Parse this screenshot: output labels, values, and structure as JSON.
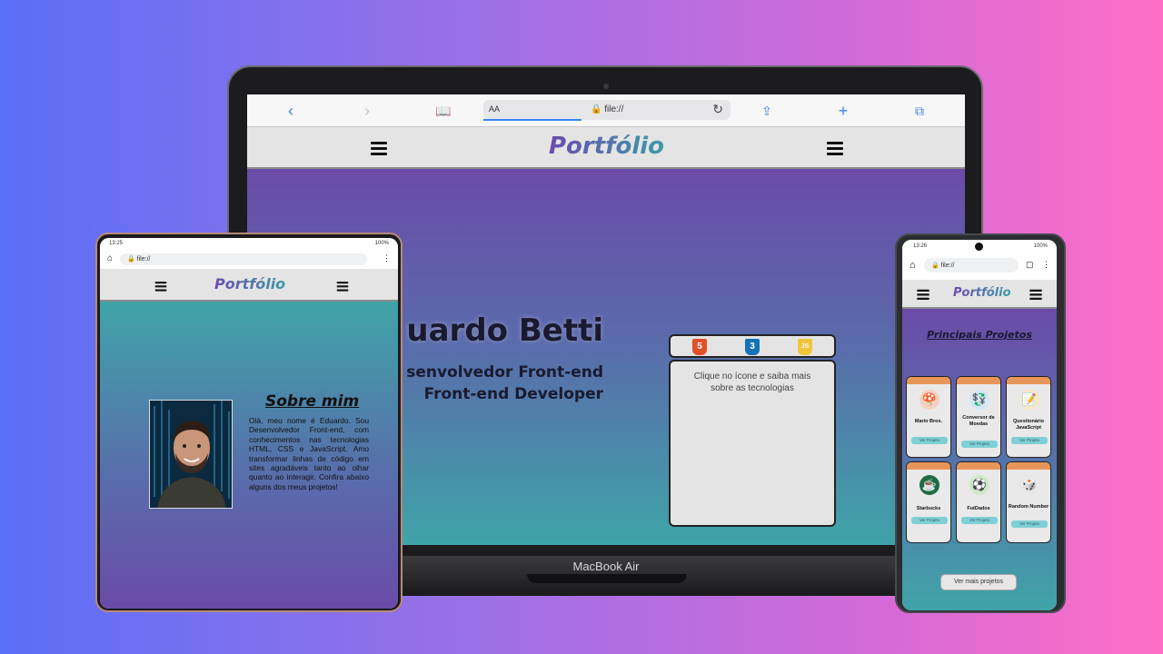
{
  "laptop": {
    "brand_label": "MacBook Air",
    "browser": {
      "url": "file://",
      "text_size_label": "AA",
      "buttons": {
        "back_icon": "chevron-left-icon",
        "forward_icon": "chevron-right-icon",
        "bookmarks_icon": "book-icon",
        "reload_icon": "reload-icon",
        "share_icon": "share-icon",
        "new_tab_icon": "plus-icon",
        "tabs_icon": "tabs-icon"
      },
      "accent": "#3b82f6"
    },
    "site": {
      "brand": "Portfólio",
      "hero": {
        "name": "uardo Betti",
        "role_pt": "senvolvedor Front-end",
        "role_en": "Front-end Developer"
      },
      "tech_panel": {
        "icons": [
          {
            "name": "html5",
            "symbol": "5",
            "color": "#e34f26"
          },
          {
            "name": "css3",
            "symbol": "3",
            "color": "#1572b6"
          },
          {
            "name": "javascript",
            "symbol": "JS",
            "color": "#f0c43b"
          }
        ],
        "hint": "Clique no ícone e saiba mais sobre as tecnologias"
      }
    }
  },
  "tablet": {
    "status": {
      "time": "13:25",
      "battery": "100%"
    },
    "url": "file://",
    "site": {
      "brand": "Portfólio",
      "about_title": "Sobre mim",
      "about_text": "Olá, meu nome é Eduardo. Sou Desenvolvedor Front-end, com conhecimentos nas tecnologias HTML, CSS e JavaScript. Amo transformar linhas de código em sites agradáveis tanto ao olhar quanto ao interagir. Confira abaixo alguns dos meus projetos!"
    }
  },
  "phone": {
    "status": {
      "time": "13:26",
      "battery": "100%"
    },
    "url": "file://",
    "site": {
      "brand": "Portfólio",
      "projects_title": "Principais Projetos",
      "projects": [
        {
          "name": "Mario Bros.",
          "icon": "mario-icon",
          "glyph": "🍄",
          "cta": "Ver Projeto"
        },
        {
          "name": "Conversor de Moedas",
          "icon": "currency-icon",
          "glyph": "💱",
          "cta": "Ver Projeto"
        },
        {
          "name": "Questionário JavaScript",
          "icon": "quiz-icon",
          "glyph": "📝",
          "cta": "Ver Projeto"
        },
        {
          "name": "Starbucks",
          "icon": "starbucks-icon",
          "glyph": "☕",
          "cta": "Ver Projeto"
        },
        {
          "name": "FutDados",
          "icon": "soccer-ball-icon",
          "glyph": "⚽",
          "cta": "Ver Projeto"
        },
        {
          "name": "Random Number",
          "icon": "dice-icon",
          "glyph": "🎲",
          "cta": "Ver Projeto"
        }
      ],
      "more_button": "Ver mais projetos"
    }
  }
}
